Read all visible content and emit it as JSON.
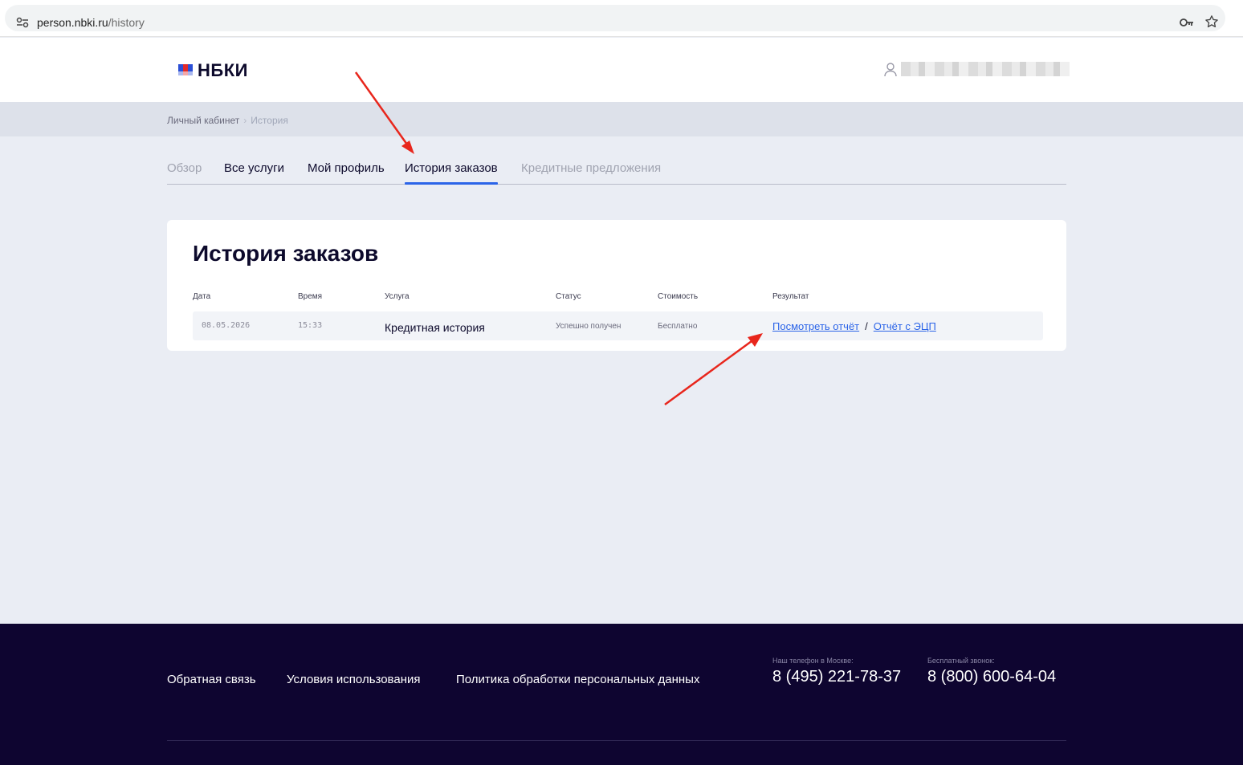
{
  "browser": {
    "url_host": "person.nbki.ru",
    "url_path": "/history"
  },
  "header": {
    "logo": "НБКИ"
  },
  "breadcrumb": {
    "root": "Личный кабинет",
    "separator": "›",
    "current": "История"
  },
  "tabs": [
    {
      "label": "Обзор",
      "state": "muted"
    },
    {
      "label": "Все услуги",
      "state": "normal"
    },
    {
      "label": "Мой профиль",
      "state": "normal"
    },
    {
      "label": "История заказов",
      "state": "active"
    },
    {
      "label": "Кредитные предложения",
      "state": "muted"
    }
  ],
  "orders": {
    "title": "История заказов",
    "columns": {
      "date": "Дата",
      "time": "Время",
      "service": "Услуга",
      "status": "Статус",
      "cost": "Стоимость",
      "result": "Результат"
    },
    "rows": [
      {
        "date": "08.05.2026",
        "time": "15:33",
        "service": "Кредитная история",
        "status": "Успешно получен",
        "cost": "Бесплатно",
        "view_link": "Посмотреть отчёт",
        "result_separator": "/",
        "ecp_link": "Отчёт с ЭЦП"
      }
    ]
  },
  "footer": {
    "links": [
      "Обратная связь",
      "Условия использования",
      "Политика обработки персональных данных"
    ],
    "phone_moscow_label": "Наш телефон в Москве:",
    "phone_moscow": "8 (495) 221-78-37",
    "phone_free_label": "Бесплатный звонок:",
    "phone_free": "8 (800) 600-64-04"
  },
  "colors": {
    "accent": "#2b64e8",
    "footer_bg": "#0e0530",
    "annotation_arrow": "#e8261c"
  }
}
